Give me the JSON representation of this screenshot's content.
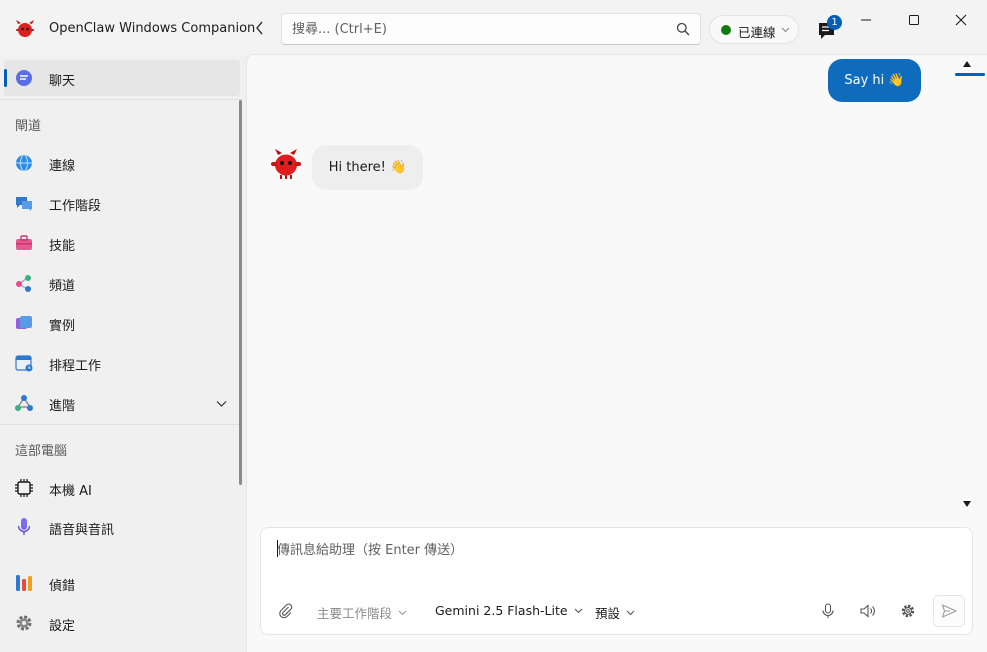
{
  "app": {
    "title": "OpenClaw Windows Companion"
  },
  "search": {
    "placeholder": "搜尋... (Ctrl+E)"
  },
  "status": {
    "label": "已連線",
    "color": "#0f7b0f"
  },
  "notifications": {
    "count": "1"
  },
  "sidebar": {
    "chat": {
      "label": "聊天",
      "icon": "chat-icon"
    },
    "section_channels": "閘道",
    "channel_items": [
      {
        "label": "連線",
        "icon": "globe-icon"
      },
      {
        "label": "工作階段",
        "icon": "sessions-icon"
      },
      {
        "label": "技能",
        "icon": "toolbox-icon"
      },
      {
        "label": "頻道",
        "icon": "channels-icon"
      },
      {
        "label": "實例",
        "icon": "instances-icon"
      },
      {
        "label": "排程工作",
        "icon": "calendar-icon"
      },
      {
        "label": "進階",
        "icon": "advanced-icon"
      }
    ],
    "section_local": "這部電腦",
    "local_items": [
      {
        "label": "本機 AI",
        "icon": "chip-icon"
      },
      {
        "label": "語音與音訊",
        "icon": "microphone-icon"
      }
    ],
    "bottom_items": [
      {
        "label": "偵錯",
        "icon": "debug-tools-icon"
      },
      {
        "label": "設定",
        "icon": "settings-gear-icon"
      }
    ]
  },
  "chat": {
    "messages": [
      {
        "role": "user",
        "text": "Say hi 👋"
      },
      {
        "role": "assistant",
        "text": "Hi there! 👋"
      }
    ]
  },
  "composer": {
    "placeholder": "傳訊息給助理（按 Enter 傳送）",
    "session_select": "主要工作階段",
    "model_select": "Gemini 2.5 Flash-Lite",
    "preset_select": "預設"
  },
  "colors": {
    "accent": "#005fb8",
    "user_bubble": "#0f6cbd",
    "bot_red": "#d91a1a"
  }
}
